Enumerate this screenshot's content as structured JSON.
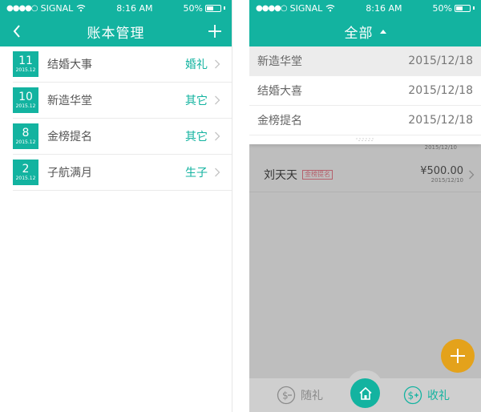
{
  "left_phone": {
    "status": {
      "carrier": "SIGNAL",
      "time": "8:16 AM",
      "battery": "50%"
    },
    "nav": {
      "title": "账本管理",
      "back_icon": "chevron-left-icon",
      "add_icon": "plus-icon"
    },
    "books": [
      {
        "day": "11",
        "ym": "2015.12",
        "name": "结婚大事",
        "tag": "婚礼"
      },
      {
        "day": "10",
        "ym": "2015.12",
        "name": "新造华堂",
        "tag": "其它"
      },
      {
        "day": "8",
        "ym": "2015.12",
        "name": "金榜提名",
        "tag": "其它"
      },
      {
        "day": "2",
        "ym": "2015.12",
        "name": "子航满月",
        "tag": "生子"
      }
    ]
  },
  "right_phone": {
    "status": {
      "carrier": "SIGNAL",
      "time": "8:16 AM",
      "battery": "50%"
    },
    "nav": {
      "title": "全部"
    },
    "dropdown": [
      {
        "name": "新造华堂",
        "date": "2015/12/18"
      },
      {
        "name": "结婚大喜",
        "date": "2015/12/18"
      },
      {
        "name": "金榜提名",
        "date": "2015/12/18"
      }
    ],
    "peek_date": "2015/12/10",
    "record": {
      "name": "刘天天",
      "tag": "金榜提名",
      "amount": "¥500.00",
      "date": "2015/12/10"
    },
    "tabbar": {
      "left_label": "随礼",
      "right_label": "收礼"
    }
  },
  "colors": {
    "accent": "#13b3a0",
    "fab": "#e4a21b",
    "tag_pink": "#e87c8b"
  }
}
